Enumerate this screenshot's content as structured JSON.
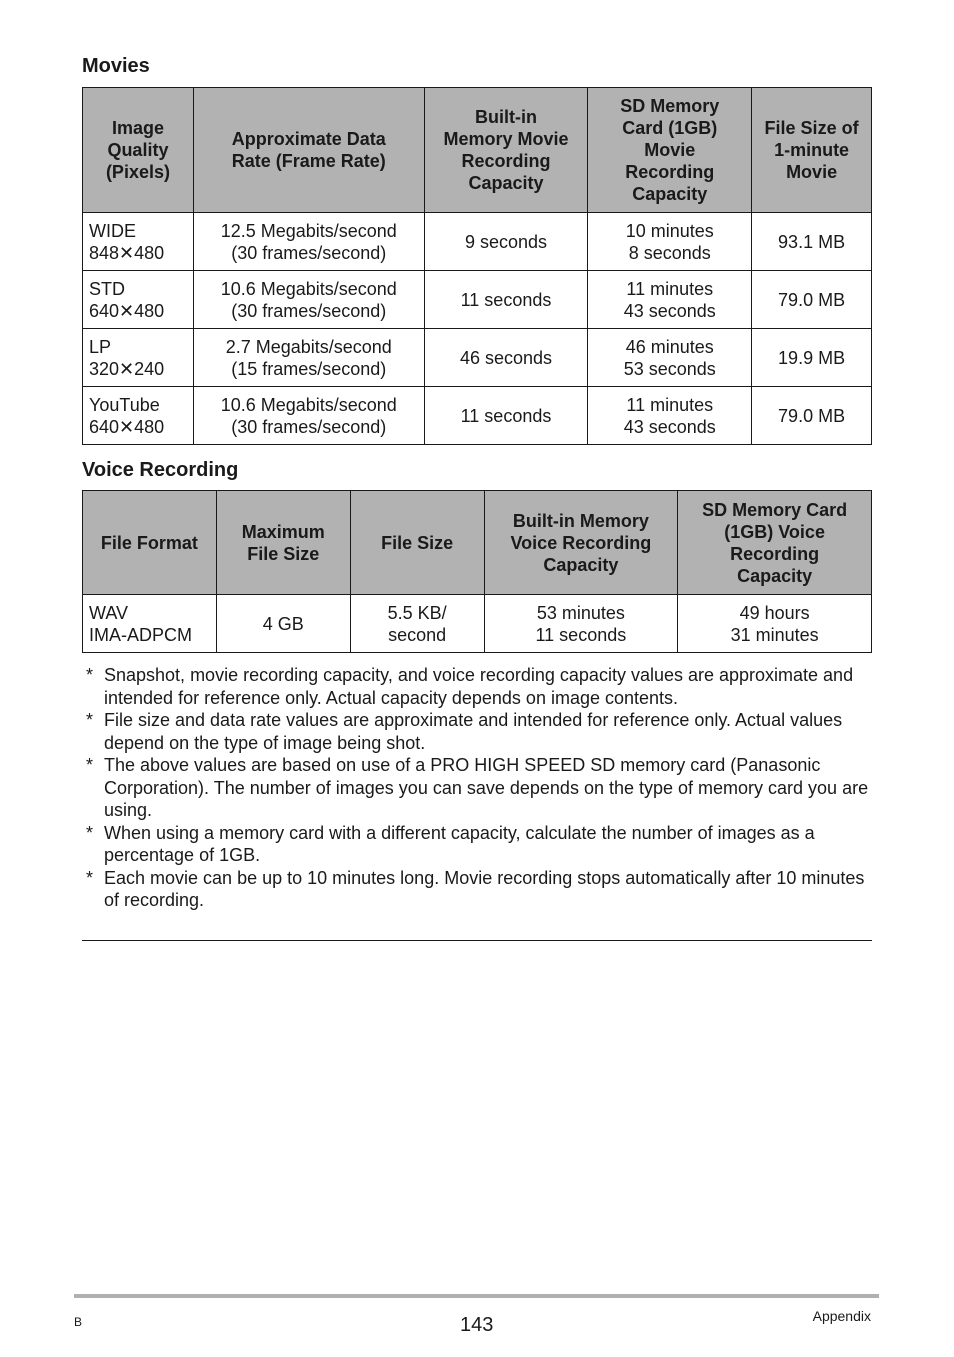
{
  "movies": {
    "title": "Movies",
    "headers": [
      [
        "Image",
        "Quality",
        "(Pixels)"
      ],
      [
        "Approximate Data",
        "Rate (Frame Rate)"
      ],
      [
        "Built-in",
        "Memory Movie",
        "Recording",
        "Capacity"
      ],
      [
        "SD Memory",
        "Card (1GB)",
        "Movie",
        "Recording",
        "Capacity"
      ],
      [
        "File Size of",
        "1-minute",
        "Movie"
      ]
    ],
    "rows": [
      {
        "quality": [
          "WIDE",
          "848✕480"
        ],
        "rate": [
          "12.5 Megabits/second",
          "(30 frames/second)"
        ],
        "builtin": "9 seconds",
        "sd": [
          "10 minutes",
          "8 seconds"
        ],
        "filesize": "93.1 MB"
      },
      {
        "quality": [
          "STD",
          "640✕480"
        ],
        "rate": [
          "10.6 Megabits/second",
          "(30 frames/second)"
        ],
        "builtin": "11 seconds",
        "sd": [
          "11 minutes",
          "43 seconds"
        ],
        "filesize": "79.0 MB"
      },
      {
        "quality": [
          "LP",
          "320✕240"
        ],
        "rate": [
          "2.7 Megabits/second",
          "(15 frames/second)"
        ],
        "builtin": "46 seconds",
        "sd": [
          "46 minutes",
          "53 seconds"
        ],
        "filesize": "19.9 MB"
      },
      {
        "quality": [
          "YouTube",
          "640✕480"
        ],
        "rate": [
          "10.6 Megabits/second",
          "(30 frames/second)"
        ],
        "builtin": "11 seconds",
        "sd": [
          "11 minutes",
          "43 seconds"
        ],
        "filesize": "79.0 MB"
      }
    ]
  },
  "voice": {
    "title": "Voice Recording",
    "headers": [
      [
        "File Format"
      ],
      [
        "Maximum",
        "File Size"
      ],
      [
        "File Size"
      ],
      [
        "Built-in Memory",
        "Voice Recording",
        "Capacity"
      ],
      [
        "SD Memory Card",
        "(1GB) Voice",
        "Recording",
        "Capacity"
      ]
    ],
    "rows": [
      {
        "format": [
          "WAV",
          "IMA-ADPCM"
        ],
        "max": "4 GB",
        "filesize": [
          "5.5 KB/",
          "second"
        ],
        "builtin": [
          "53 minutes",
          "11 seconds"
        ],
        "sd": [
          "49 hours",
          "31 minutes"
        ]
      }
    ]
  },
  "notes": {
    "star": "*",
    "items": [
      "Snapshot, movie recording capacity, and voice recording capacity values are approximate and intended for reference only. Actual capacity depends on image contents.",
      "File size and data rate values are approximate and intended for reference only. Actual values depend on the type of image being shot.",
      "The above values are based on use of a PRO HIGH SPEED SD memory card (Panasonic Corporation). The number of images you can save depends on the type of memory card you are using.",
      "When using a memory card with a different capacity, calculate the number of images as a percentage of 1GB.",
      "Each movie can be up to 10 minutes long. Movie recording stops automatically after 10 minutes of recording."
    ]
  },
  "footer": {
    "left": "B",
    "page_number": "143",
    "section": "Appendix"
  }
}
